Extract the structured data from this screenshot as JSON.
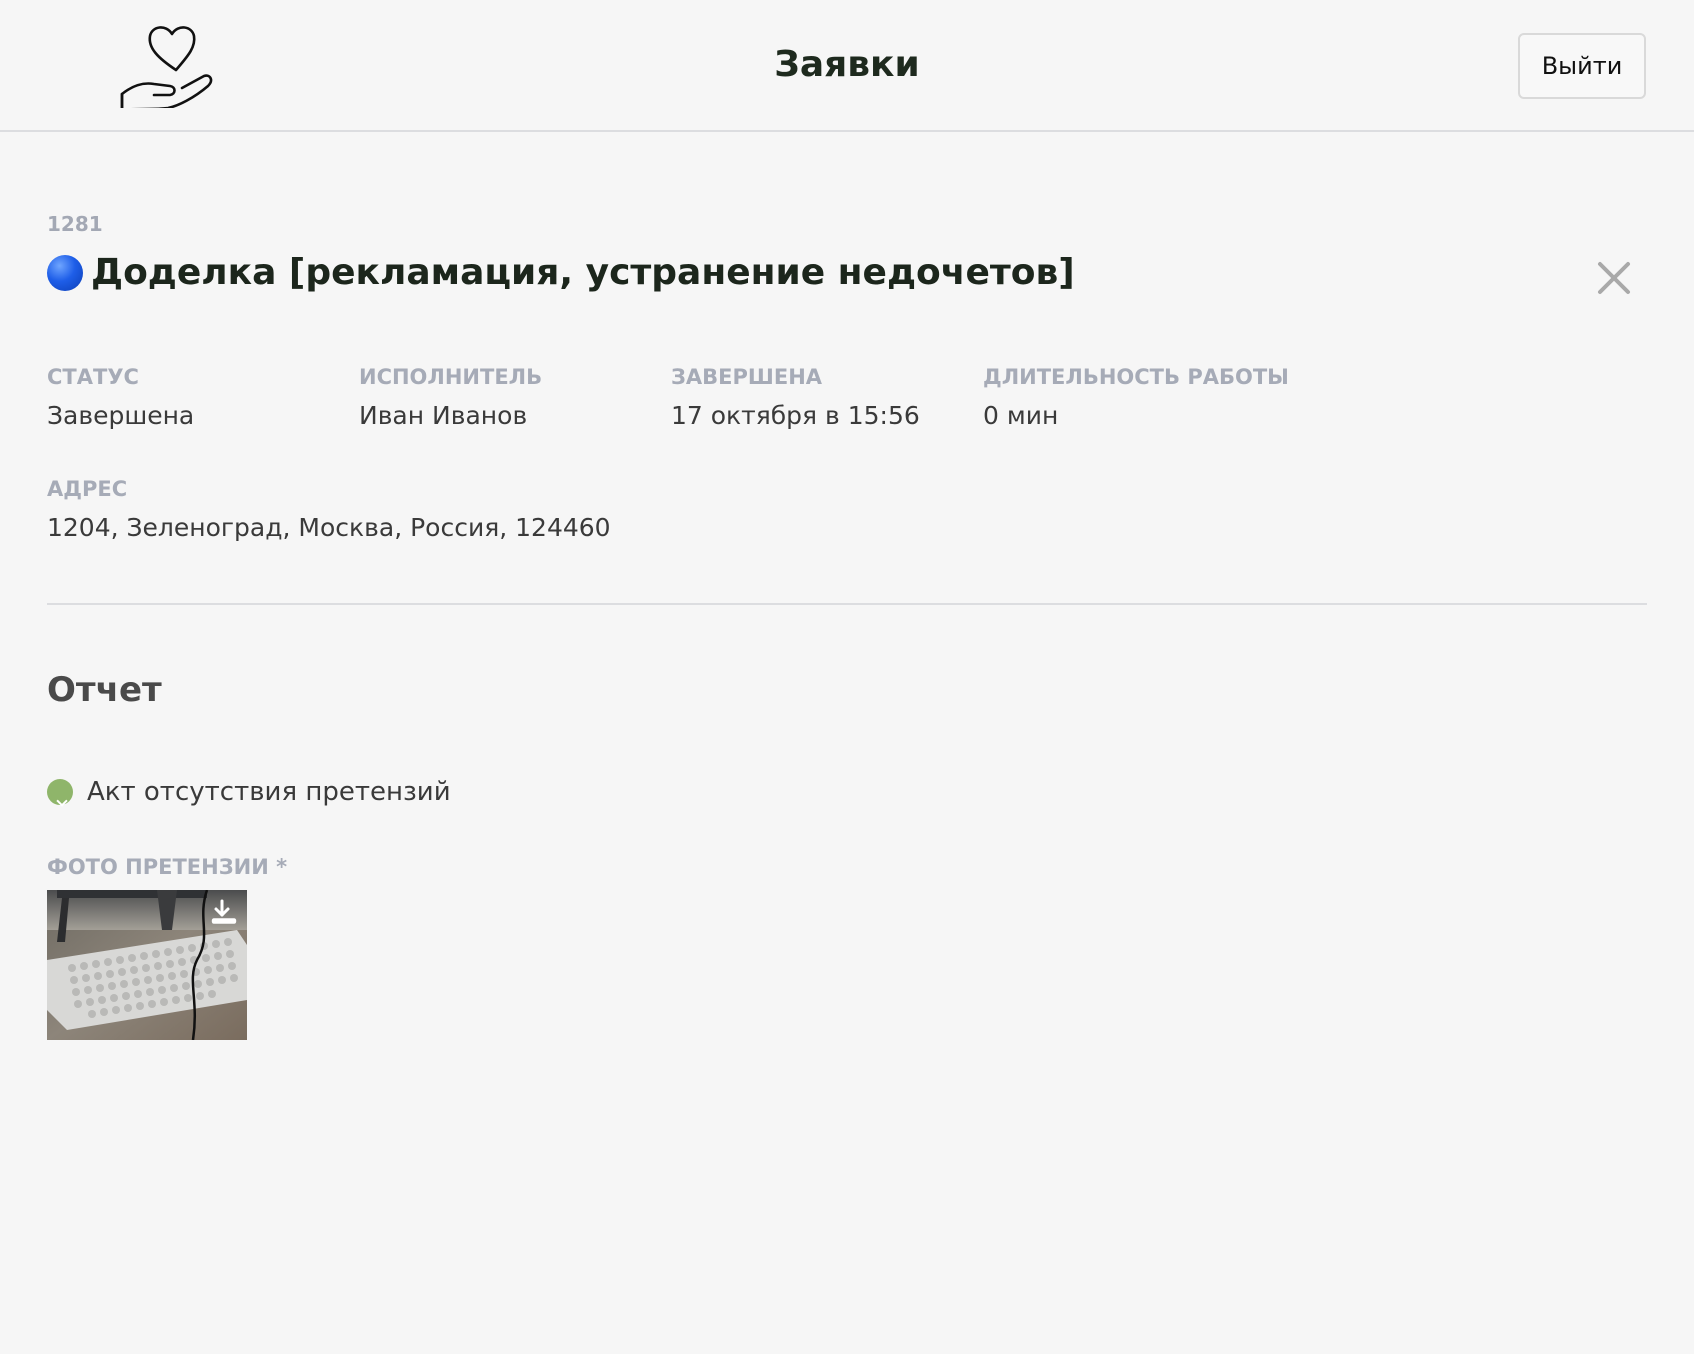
{
  "header": {
    "title": "Заявки",
    "logout_label": "Выйти",
    "logo_icon": "heart-hand-icon"
  },
  "order": {
    "number": "1281",
    "status_color": "#1e5ee8",
    "title": "Доделка [рекламация, устранение недочетов]",
    "close_icon": "close-icon"
  },
  "details": {
    "status_label": "СТАТУС",
    "status_value": "Завершена",
    "executor_label": "ИСПОЛНИТЕЛЬ",
    "executor_value": "Иван Иванов",
    "completed_label": "ЗАВЕРШЕНА",
    "completed_value": "17 октября в 15:56",
    "duration_label": "ДЛИТЕЛЬНОСТЬ РАБОТЫ",
    "duration_value": "0 мин",
    "address_label": "АДРЕС",
    "address_value": "1204, Зеленоград, Москва, Россия, 124460"
  },
  "report": {
    "title": "Отчет",
    "check_item_label": "Акт отсутствия претензий",
    "check_item_color": "#8fb56a",
    "photo_label": "ФОТО ПРЕТЕНЗИИ *",
    "photo_download_icon": "download-icon"
  }
}
